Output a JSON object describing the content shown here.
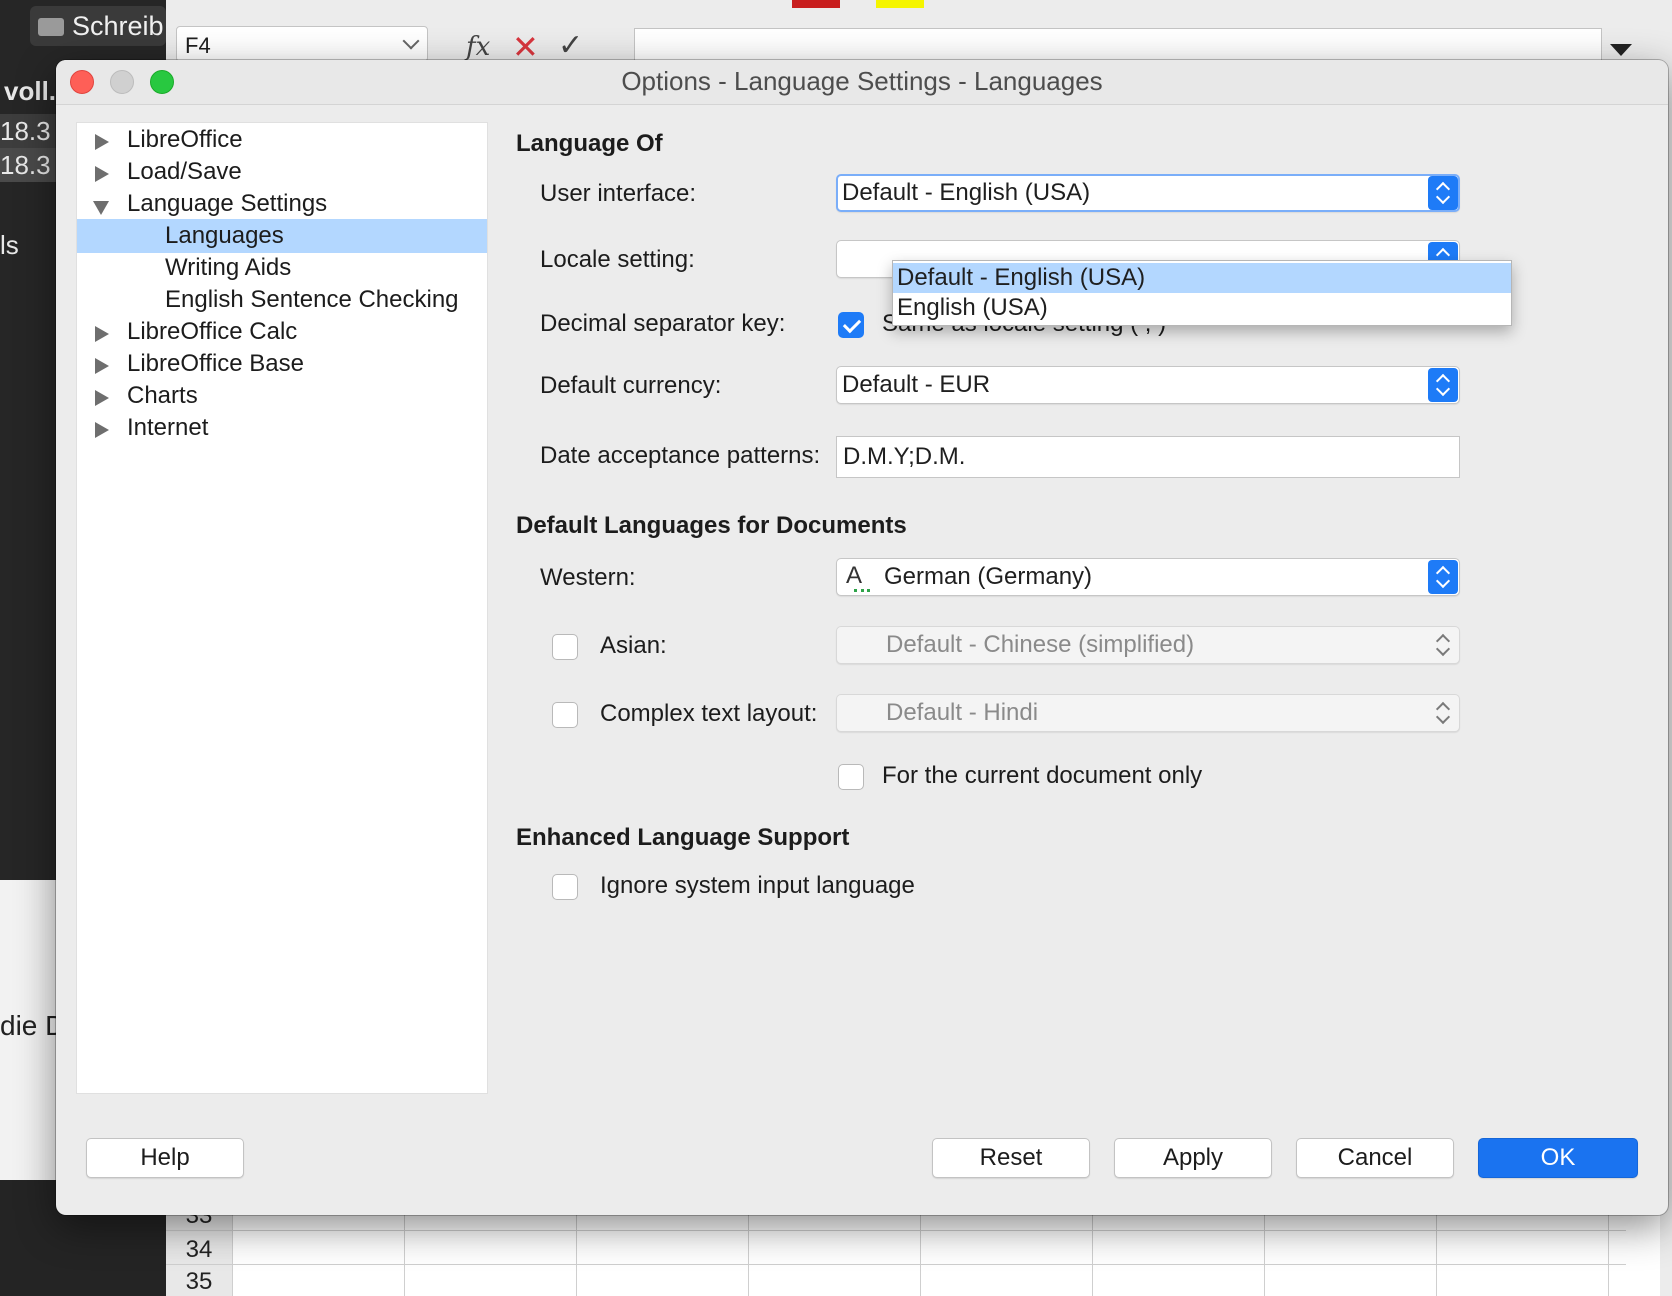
{
  "background": {
    "doc_title": "Schreib",
    "left_fragments": [
      "voll.",
      "18.3",
      "18.3",
      "ls",
      "die D"
    ],
    "name_box": "F4",
    "row_numbers": [
      "33",
      "34",
      "35"
    ]
  },
  "dialog": {
    "title": "Options - Language Settings - Languages",
    "tree": [
      {
        "label": "LibreOffice"
      },
      {
        "label": "Load/Save"
      },
      {
        "label": "Language Settings"
      },
      {
        "label": "Languages"
      },
      {
        "label": "Writing Aids"
      },
      {
        "label": "English Sentence Checking"
      },
      {
        "label": "LibreOffice Calc"
      },
      {
        "label": "LibreOffice Base"
      },
      {
        "label": "Charts"
      },
      {
        "label": "Internet"
      }
    ],
    "language_of": {
      "heading": "Language Of",
      "user_interface_label": "User interface:",
      "user_interface_value": "Default - English (USA)",
      "user_interface_options": [
        "Default - English (USA)",
        "English (USA)"
      ],
      "locale_label": "Locale setting:",
      "decimal_label": "Decimal separator key:",
      "decimal_checkbox_label": "Same as locale setting ( , )",
      "decimal_checked": true,
      "currency_label": "Default currency:",
      "currency_value": "Default - EUR",
      "date_label": "Date acceptance patterns:",
      "date_value": "D.M.Y;D.M."
    },
    "default_languages": {
      "heading": "Default Languages for Documents",
      "western_label": "Western:",
      "western_value": "German (Germany)",
      "asian_label": "Asian:",
      "asian_value": "Default - Chinese (simplified)",
      "asian_checked": false,
      "ctl_label": "Complex text layout:",
      "ctl_value": "Default - Hindi",
      "ctl_checked": false,
      "current_doc_label": "For the current document only",
      "current_doc_checked": false
    },
    "enhanced": {
      "heading": "Enhanced Language Support",
      "ignore_label": "Ignore system input language",
      "ignore_checked": false
    },
    "buttons": {
      "help": "Help",
      "reset": "Reset",
      "apply": "Apply",
      "cancel": "Cancel",
      "ok": "OK"
    },
    "colors": {
      "accent": "#1a73f0",
      "selection": "#b3d7ff"
    }
  }
}
